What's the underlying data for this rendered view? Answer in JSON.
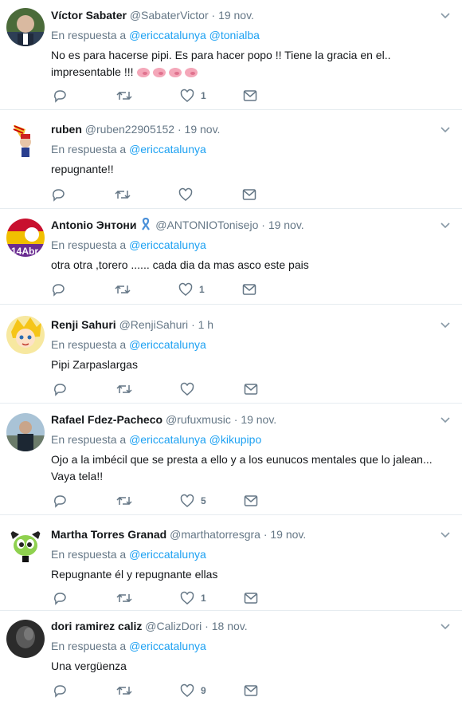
{
  "reply_prefix": "En respuesta a",
  "colors": {
    "link": "#1da1f2",
    "muted": "#657786",
    "text": "#14171a",
    "divider": "#e6ecf0"
  },
  "tweets": [
    {
      "name": "Víctor Sabater",
      "handle": "@SabaterVictor",
      "time": "19 nov.",
      "reply_to": [
        "@ericcatalunya",
        "@tonialba"
      ],
      "text_line1": "No es para hacerse pipi. Es para hacer popo !! Tiene la gracia en el..",
      "text_line2": "impresentable !!!",
      "pig_emoji_icon": "pig-face-icon x4",
      "likes": "1"
    },
    {
      "name": "ruben",
      "handle": "@ruben22905152",
      "time": "19 nov.",
      "reply_to": [
        "@ericcatalunya"
      ],
      "text_line1": "repugnante!!",
      "likes": ""
    },
    {
      "name": "Antonio Энтони",
      "handle": "@ANTONIOTonisejo",
      "time": "19 nov.",
      "reply_to": [
        "@ericcatalunya"
      ],
      "text_line1": "otra otra ,torero ...... cada dia da mas asco este pais",
      "likes": "1"
    },
    {
      "name": "Renji Sahuri",
      "handle": "@RenjiSahuri",
      "time": "1 h",
      "reply_to": [
        "@ericcatalunya"
      ],
      "text_line1": "Pipi Zarpaslargas",
      "likes": ""
    },
    {
      "name": "Rafael Fdez-Pacheco",
      "handle": "@rufuxmusic",
      "time": "19 nov.",
      "reply_to": [
        "@ericcatalunya",
        "@kikupipo"
      ],
      "text_line1": "Ojo a la imbécil que se presta a ello y a los eunucos mentales que lo jalean...",
      "text_line2": "Vaya tela!!",
      "likes": "5"
    },
    {
      "name": "Martha Torres Granad",
      "handle": "@marthatorresgra",
      "time": "19 nov.",
      "reply_to": [
        "@ericcatalunya"
      ],
      "text_line1": "Repugnante él y repugnante ellas",
      "likes": "1"
    },
    {
      "name": "dori ramirez caliz",
      "handle": "@CalizDori",
      "time": "18 nov.",
      "reply_to": [
        "@ericcatalunya"
      ],
      "text_line1": "Una vergüenza",
      "likes": "9"
    }
  ]
}
